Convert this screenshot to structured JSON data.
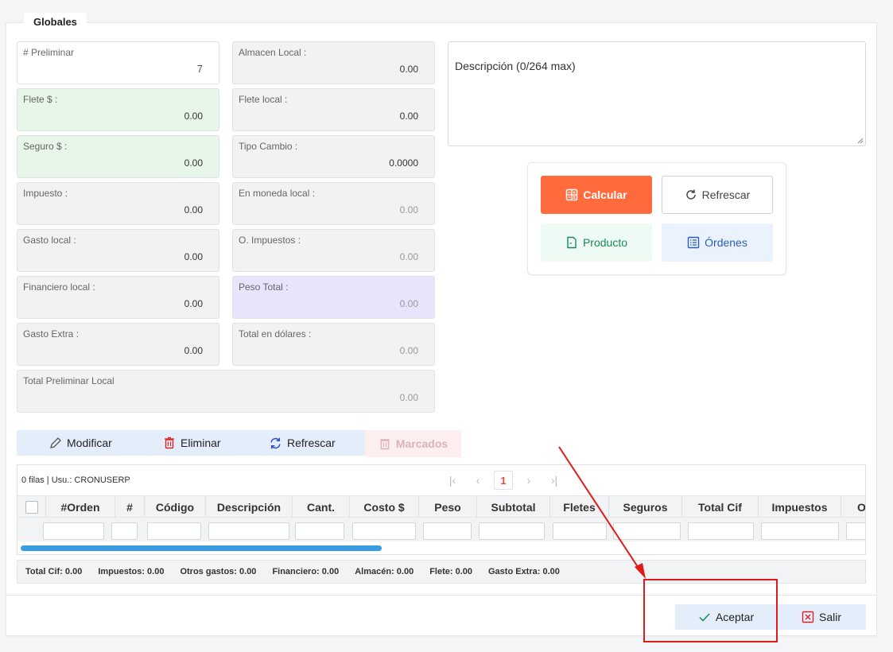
{
  "tab": {
    "title": "Globales"
  },
  "fields_left": [
    {
      "label": "# Preliminar",
      "value": "7",
      "style": "white"
    },
    {
      "label": "Flete $ :",
      "value": "0.00",
      "style": "green"
    },
    {
      "label": "Seguro $ :",
      "value": "0.00",
      "style": "green"
    },
    {
      "label": "Impuesto :",
      "value": "0.00",
      "style": "gray"
    },
    {
      "label": "Gasto local :",
      "value": "0.00",
      "style": "gray"
    },
    {
      "label": "Financiero local :",
      "value": "0.00",
      "style": "gray"
    },
    {
      "label": "Gasto Extra :",
      "value": "0.00",
      "style": "gray"
    }
  ],
  "fields_right": [
    {
      "label": "Almacen Local :",
      "value": "0.00",
      "style": "gray"
    },
    {
      "label": "Flete local :",
      "value": "0.00",
      "style": "gray"
    },
    {
      "label": "Tipo Cambio :",
      "value": "0.0000",
      "style": "gray"
    },
    {
      "label": "En moneda local :",
      "value": "0.00",
      "style": "muted"
    },
    {
      "label": "O. Impuestos :",
      "value": "0.00",
      "style": "muted"
    },
    {
      "label": "Peso Total :",
      "value": "0.00",
      "style": "purple"
    },
    {
      "label": "Total en dólares :",
      "value": "0.00",
      "style": "muted"
    }
  ],
  "total_preliminar": {
    "label": "Total Preliminar Local",
    "value": "0.00"
  },
  "description": {
    "label": "Descripción (0/264 max)"
  },
  "actions": {
    "calcular": "Calcular",
    "refrescar": "Refrescar",
    "producto": "Producto",
    "ordenes": "Órdenes"
  },
  "toolbar": {
    "modificar": "Modificar",
    "eliminar": "Eliminar",
    "refrescar": "Refrescar",
    "marcados": "Marcados"
  },
  "grid": {
    "info": "0 filas | Usu.: CRONUSERP",
    "page": "1",
    "columns": [
      "#Orden",
      "#",
      "Código",
      "Descripción",
      "Cant.",
      "Costo $",
      "Peso",
      "Subtotal",
      "Fletes",
      "Seguros",
      "Total Cif",
      "Impuestos",
      "O"
    ]
  },
  "totals": [
    "Total Cif: 0.00",
    "Impuestos: 0.00",
    "Otros gastos: 0.00",
    "Financiero: 0.00",
    "Almacén: 0.00",
    "Flete: 0.00",
    "Gasto Extra: 0.00"
  ],
  "footer": {
    "aceptar": "Aceptar",
    "salir": "Salir"
  },
  "colors": {
    "calcular": "#ff6b3d",
    "annotation": "#e0191b",
    "scrollbar": "#3a9be0"
  }
}
